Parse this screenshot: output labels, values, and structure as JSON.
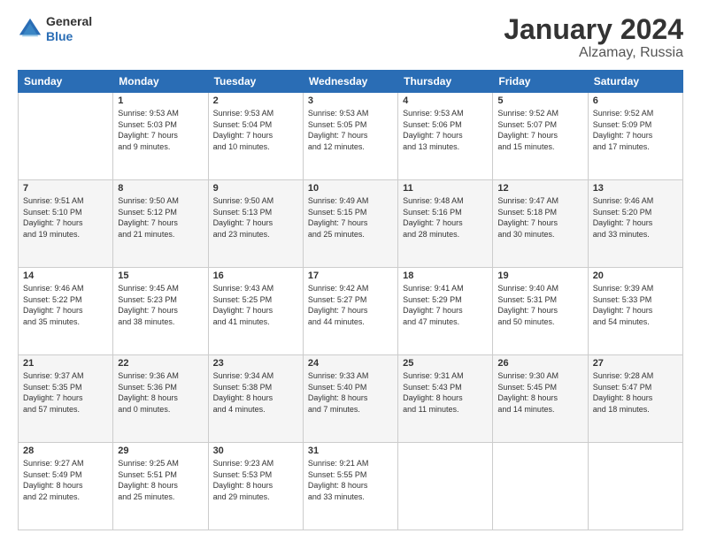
{
  "header": {
    "logo_line1": "General",
    "logo_line2": "Blue",
    "main_title": "January 2024",
    "subtitle": "Alzamay, Russia"
  },
  "days_of_week": [
    "Sunday",
    "Monday",
    "Tuesday",
    "Wednesday",
    "Thursday",
    "Friday",
    "Saturday"
  ],
  "weeks": [
    [
      {
        "day": "",
        "info": ""
      },
      {
        "day": "1",
        "info": "Sunrise: 9:53 AM\nSunset: 5:03 PM\nDaylight: 7 hours\nand 9 minutes."
      },
      {
        "day": "2",
        "info": "Sunrise: 9:53 AM\nSunset: 5:04 PM\nDaylight: 7 hours\nand 10 minutes."
      },
      {
        "day": "3",
        "info": "Sunrise: 9:53 AM\nSunset: 5:05 PM\nDaylight: 7 hours\nand 12 minutes."
      },
      {
        "day": "4",
        "info": "Sunrise: 9:53 AM\nSunset: 5:06 PM\nDaylight: 7 hours\nand 13 minutes."
      },
      {
        "day": "5",
        "info": "Sunrise: 9:52 AM\nSunset: 5:07 PM\nDaylight: 7 hours\nand 15 minutes."
      },
      {
        "day": "6",
        "info": "Sunrise: 9:52 AM\nSunset: 5:09 PM\nDaylight: 7 hours\nand 17 minutes."
      }
    ],
    [
      {
        "day": "7",
        "info": "Sunrise: 9:51 AM\nSunset: 5:10 PM\nDaylight: 7 hours\nand 19 minutes."
      },
      {
        "day": "8",
        "info": "Sunrise: 9:50 AM\nSunset: 5:12 PM\nDaylight: 7 hours\nand 21 minutes."
      },
      {
        "day": "9",
        "info": "Sunrise: 9:50 AM\nSunset: 5:13 PM\nDaylight: 7 hours\nand 23 minutes."
      },
      {
        "day": "10",
        "info": "Sunrise: 9:49 AM\nSunset: 5:15 PM\nDaylight: 7 hours\nand 25 minutes."
      },
      {
        "day": "11",
        "info": "Sunrise: 9:48 AM\nSunset: 5:16 PM\nDaylight: 7 hours\nand 28 minutes."
      },
      {
        "day": "12",
        "info": "Sunrise: 9:47 AM\nSunset: 5:18 PM\nDaylight: 7 hours\nand 30 minutes."
      },
      {
        "day": "13",
        "info": "Sunrise: 9:46 AM\nSunset: 5:20 PM\nDaylight: 7 hours\nand 33 minutes."
      }
    ],
    [
      {
        "day": "14",
        "info": "Sunrise: 9:46 AM\nSunset: 5:22 PM\nDaylight: 7 hours\nand 35 minutes."
      },
      {
        "day": "15",
        "info": "Sunrise: 9:45 AM\nSunset: 5:23 PM\nDaylight: 7 hours\nand 38 minutes."
      },
      {
        "day": "16",
        "info": "Sunrise: 9:43 AM\nSunset: 5:25 PM\nDaylight: 7 hours\nand 41 minutes."
      },
      {
        "day": "17",
        "info": "Sunrise: 9:42 AM\nSunset: 5:27 PM\nDaylight: 7 hours\nand 44 minutes."
      },
      {
        "day": "18",
        "info": "Sunrise: 9:41 AM\nSunset: 5:29 PM\nDaylight: 7 hours\nand 47 minutes."
      },
      {
        "day": "19",
        "info": "Sunrise: 9:40 AM\nSunset: 5:31 PM\nDaylight: 7 hours\nand 50 minutes."
      },
      {
        "day": "20",
        "info": "Sunrise: 9:39 AM\nSunset: 5:33 PM\nDaylight: 7 hours\nand 54 minutes."
      }
    ],
    [
      {
        "day": "21",
        "info": "Sunrise: 9:37 AM\nSunset: 5:35 PM\nDaylight: 7 hours\nand 57 minutes."
      },
      {
        "day": "22",
        "info": "Sunrise: 9:36 AM\nSunset: 5:36 PM\nDaylight: 8 hours\nand 0 minutes."
      },
      {
        "day": "23",
        "info": "Sunrise: 9:34 AM\nSunset: 5:38 PM\nDaylight: 8 hours\nand 4 minutes."
      },
      {
        "day": "24",
        "info": "Sunrise: 9:33 AM\nSunset: 5:40 PM\nDaylight: 8 hours\nand 7 minutes."
      },
      {
        "day": "25",
        "info": "Sunrise: 9:31 AM\nSunset: 5:43 PM\nDaylight: 8 hours\nand 11 minutes."
      },
      {
        "day": "26",
        "info": "Sunrise: 9:30 AM\nSunset: 5:45 PM\nDaylight: 8 hours\nand 14 minutes."
      },
      {
        "day": "27",
        "info": "Sunrise: 9:28 AM\nSunset: 5:47 PM\nDaylight: 8 hours\nand 18 minutes."
      }
    ],
    [
      {
        "day": "28",
        "info": "Sunrise: 9:27 AM\nSunset: 5:49 PM\nDaylight: 8 hours\nand 22 minutes."
      },
      {
        "day": "29",
        "info": "Sunrise: 9:25 AM\nSunset: 5:51 PM\nDaylight: 8 hours\nand 25 minutes."
      },
      {
        "day": "30",
        "info": "Sunrise: 9:23 AM\nSunset: 5:53 PM\nDaylight: 8 hours\nand 29 minutes."
      },
      {
        "day": "31",
        "info": "Sunrise: 9:21 AM\nSunset: 5:55 PM\nDaylight: 8 hours\nand 33 minutes."
      },
      {
        "day": "",
        "info": ""
      },
      {
        "day": "",
        "info": ""
      },
      {
        "day": "",
        "info": ""
      }
    ]
  ]
}
